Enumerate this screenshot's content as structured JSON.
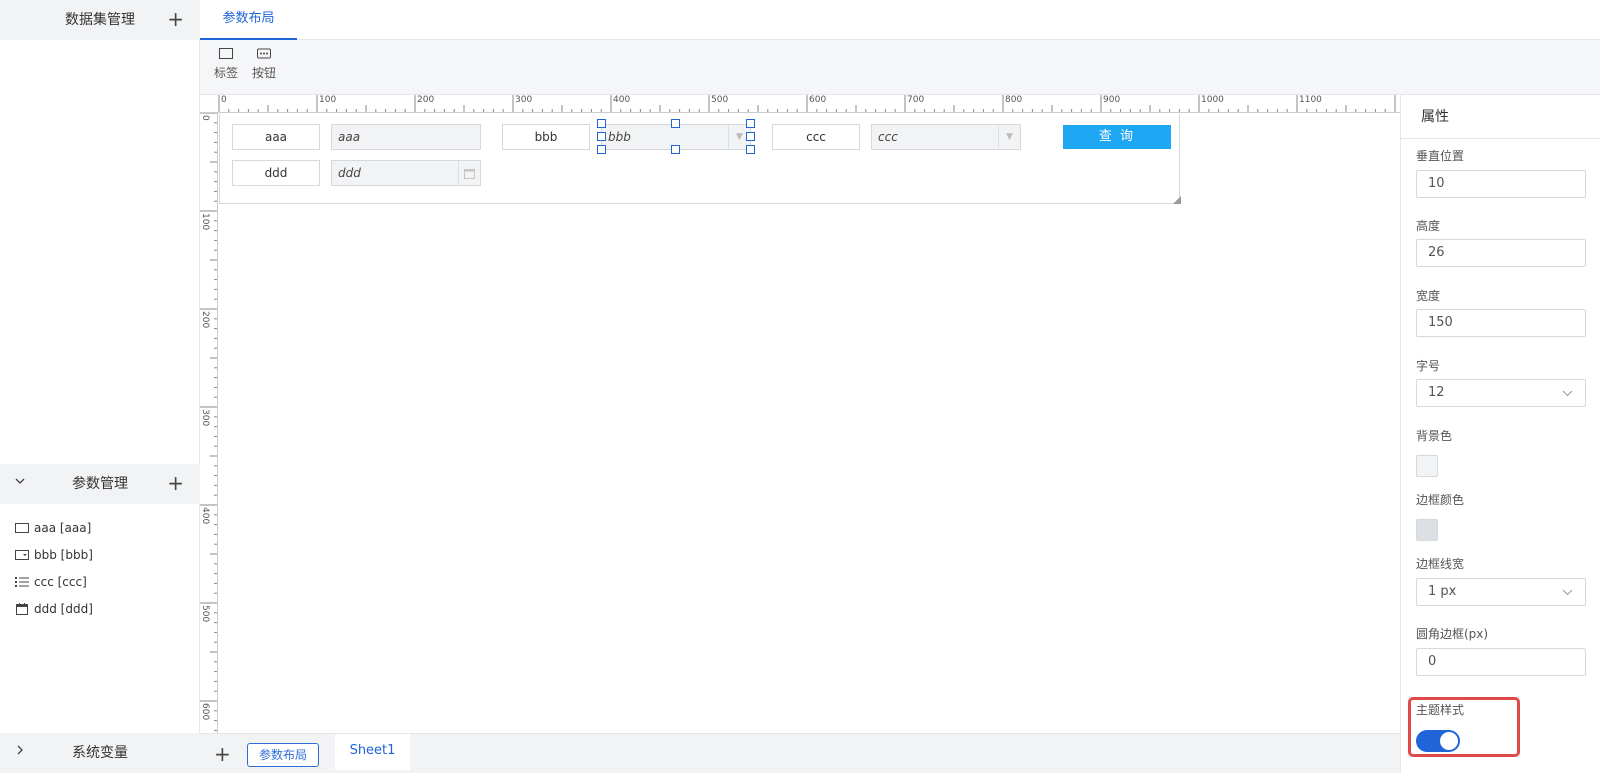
{
  "left_panel": {
    "dataset_title": "数据集管理",
    "params_title": "参数管理",
    "sysvars_title": "系统变量",
    "params": [
      {
        "label": "aaa [aaa]",
        "icon": "label-box-icon"
      },
      {
        "label": "bbb [bbb]",
        "icon": "dropdown-box-icon"
      },
      {
        "label": "ccc [ccc]",
        "icon": "list-icon"
      },
      {
        "label": "ddd [ddd]",
        "icon": "calendar-icon"
      }
    ]
  },
  "tabs": {
    "layout": "参数布局"
  },
  "toolbar": {
    "label_tool": "标签",
    "button_tool": "按钮"
  },
  "rulers": {
    "horizontal": [
      "0",
      "100",
      "200",
      "300",
      "400",
      "500",
      "600",
      "700",
      "800",
      "900",
      "1000",
      "1100"
    ],
    "vertical": [
      "0",
      "100",
      "200",
      "300",
      "400",
      "500",
      "600"
    ]
  },
  "canvas": {
    "row1": {
      "aaa_label": "aaa",
      "aaa_input": "aaa",
      "bbb_label": "bbb",
      "bbb_input": "bbb",
      "ccc_label": "ccc",
      "ccc_input": "ccc"
    },
    "row2": {
      "ddd_label": "ddd",
      "ddd_input": "ddd"
    },
    "query_button": "查 询"
  },
  "sheetbar": {
    "param_tab": "参数布局",
    "sheet_tab": "Sheet1"
  },
  "properties": {
    "title": "属性",
    "vertical_position_label": "垂直位置",
    "vertical_position": "10",
    "height_label": "高度",
    "height": "26",
    "width_label": "宽度",
    "width": "150",
    "font_size_label": "字号",
    "font_size": "12",
    "background_label": "背景色",
    "background_color": "#f2f3f5",
    "border_color_label": "边框颜色",
    "border_color": "#dcdfe4",
    "border_width_label": "边框线宽",
    "border_width": "1 px",
    "radius_label": "圆角边框(px)",
    "radius": "0",
    "theme_label": "主题样式",
    "theme_enabled": true
  },
  "colors": {
    "accent": "#1f64d8",
    "button": "#1ea7f3",
    "highlight": "#e04a4a"
  }
}
